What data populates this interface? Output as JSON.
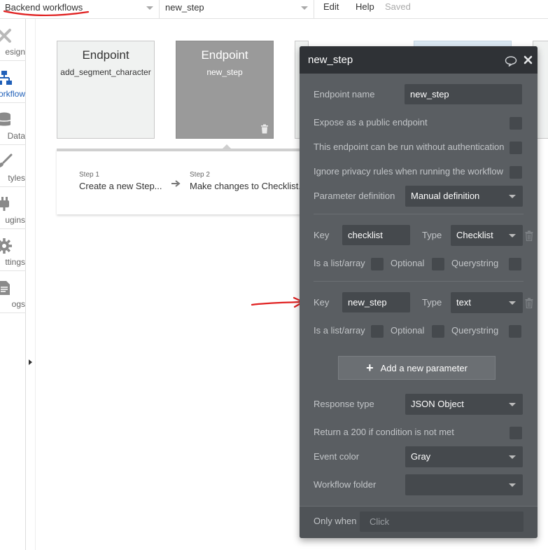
{
  "topbar": {
    "page_dropdown": "Backend workflows",
    "workflow_dropdown": "new_step",
    "menu": [
      "Edit",
      "Help"
    ],
    "status": "Saved"
  },
  "sidebar": {
    "items": [
      {
        "label": "esign",
        "icon": "design-icon"
      },
      {
        "label": "orkflow",
        "icon": "workflow-icon",
        "active": true
      },
      {
        "label": "Data",
        "icon": "database-icon"
      },
      {
        "label": "tyles",
        "icon": "brush-icon"
      },
      {
        "label": "ugins",
        "icon": "plug-icon"
      },
      {
        "label": "ttings",
        "icon": "gear-icon"
      },
      {
        "label": "ogs",
        "icon": "logs-icon"
      }
    ]
  },
  "canvas": {
    "cards": [
      {
        "title": "Endpoint",
        "name": "add_segment_character"
      },
      {
        "title": "Endpoint",
        "name": "new_step"
      }
    ],
    "steps": [
      {
        "label": "Step 1",
        "name": "Create a new Step..."
      },
      {
        "label": "Step 2",
        "name": "Make changes to Checklist..."
      }
    ]
  },
  "editor": {
    "title": "new_step",
    "endpoint_name_label": "Endpoint name",
    "endpoint_name_value": "new_step",
    "expose_label": "Expose as a public endpoint",
    "no_auth_label": "This endpoint can be run without authentication",
    "ignore_privacy_label": "Ignore privacy rules when running the workflow",
    "param_def_label": "Parameter definition",
    "param_def_value": "Manual definition",
    "parameters": [
      {
        "key_label": "Key",
        "key": "checklist",
        "type_label": "Type",
        "type": "Checklist",
        "list_label": "Is a list/array",
        "optional_label": "Optional",
        "querystring_label": "Querystring"
      },
      {
        "key_label": "Key",
        "key": "new_step",
        "type_label": "Type",
        "type": "text",
        "list_label": "Is a list/array",
        "optional_label": "Optional",
        "querystring_label": "Querystring"
      }
    ],
    "add_param_label": "Add a new parameter",
    "response_type_label": "Response type",
    "response_type_value": "JSON Object",
    "return_200_label": "Return a 200 if condition is not met",
    "event_color_label": "Event color",
    "event_color_value": "Gray",
    "folder_label": "Workflow folder",
    "folder_value": "",
    "only_when_label": "Only when",
    "only_when_placeholder": "Click"
  },
  "colors": {
    "panel_bg": "#5a5e62",
    "panel_header": "#2f3236",
    "annotation_red": "#e02020",
    "active_blue": "#1f5fb8"
  }
}
